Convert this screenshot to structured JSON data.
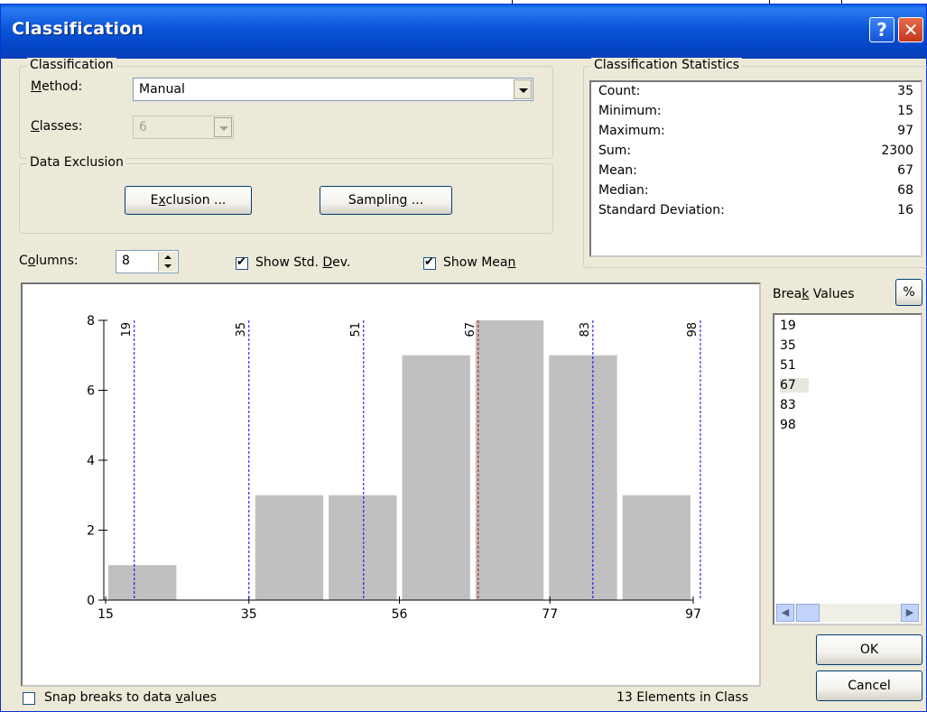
{
  "window": {
    "title": "Classification"
  },
  "classification": {
    "group_label": "Classification",
    "method_label": "Method:",
    "method_value": "Manual",
    "classes_label": "Classes:",
    "classes_value": "6"
  },
  "data_exclusion": {
    "group_label": "Data Exclusion",
    "exclusion_button": "Exclusion ...",
    "sampling_button": "Sampling ..."
  },
  "statistics": {
    "group_label": "Classification Statistics",
    "rows": [
      {
        "key": "Count:",
        "value": "35"
      },
      {
        "key": "Minimum:",
        "value": "15"
      },
      {
        "key": "Maximum:",
        "value": "97"
      },
      {
        "key": "Sum:",
        "value": "2300"
      },
      {
        "key": "Mean:",
        "value": "67"
      },
      {
        "key": "Median:",
        "value": "68"
      },
      {
        "key": "Standard Deviation:",
        "value": "16"
      }
    ]
  },
  "controls": {
    "columns_label": "Columns:",
    "columns_value": "8",
    "show_std_dev": "Show Std. Dev.",
    "show_std_dev_checked": true,
    "show_mean": "Show Mean",
    "show_mean_checked": true
  },
  "break_values": {
    "label": "Break Values",
    "percent_button": "%",
    "items": [
      "19",
      "35",
      "51",
      "67",
      "83",
      "98"
    ],
    "selected_index": 3
  },
  "buttons": {
    "ok": "OK",
    "cancel": "Cancel"
  },
  "footer": {
    "snap_label": "Snap breaks to data values",
    "snap_checked": false,
    "elements_text": "13 Elements in Class"
  },
  "chart_data": {
    "type": "bar",
    "title": "",
    "xlabel": "",
    "ylabel": "",
    "xlim": [
      15,
      97
    ],
    "ylim": [
      0,
      8
    ],
    "x_ticks": [
      "15",
      "35",
      "56",
      "77",
      "97"
    ],
    "y_ticks": [
      "0",
      "2",
      "4",
      "6",
      "8"
    ],
    "bins": [
      {
        "from": 15.0,
        "to": 25.25,
        "count": 1
      },
      {
        "from": 25.25,
        "to": 35.5,
        "count": 0
      },
      {
        "from": 35.5,
        "to": 45.75,
        "count": 3
      },
      {
        "from": 45.75,
        "to": 56.0,
        "count": 3
      },
      {
        "from": 56.0,
        "to": 66.25,
        "count": 7
      },
      {
        "from": 66.25,
        "to": 76.5,
        "count": 8
      },
      {
        "from": 76.5,
        "to": 86.75,
        "count": 7
      },
      {
        "from": 86.75,
        "to": 97.0,
        "count": 3
      }
    ],
    "bar_color": "#c0c0c0",
    "break_lines": [
      19,
      35,
      51,
      67,
      83,
      98
    ],
    "break_line_color": "#0000ff",
    "mean_line": 67,
    "mean_line_color": "#c00000",
    "grid": false
  }
}
